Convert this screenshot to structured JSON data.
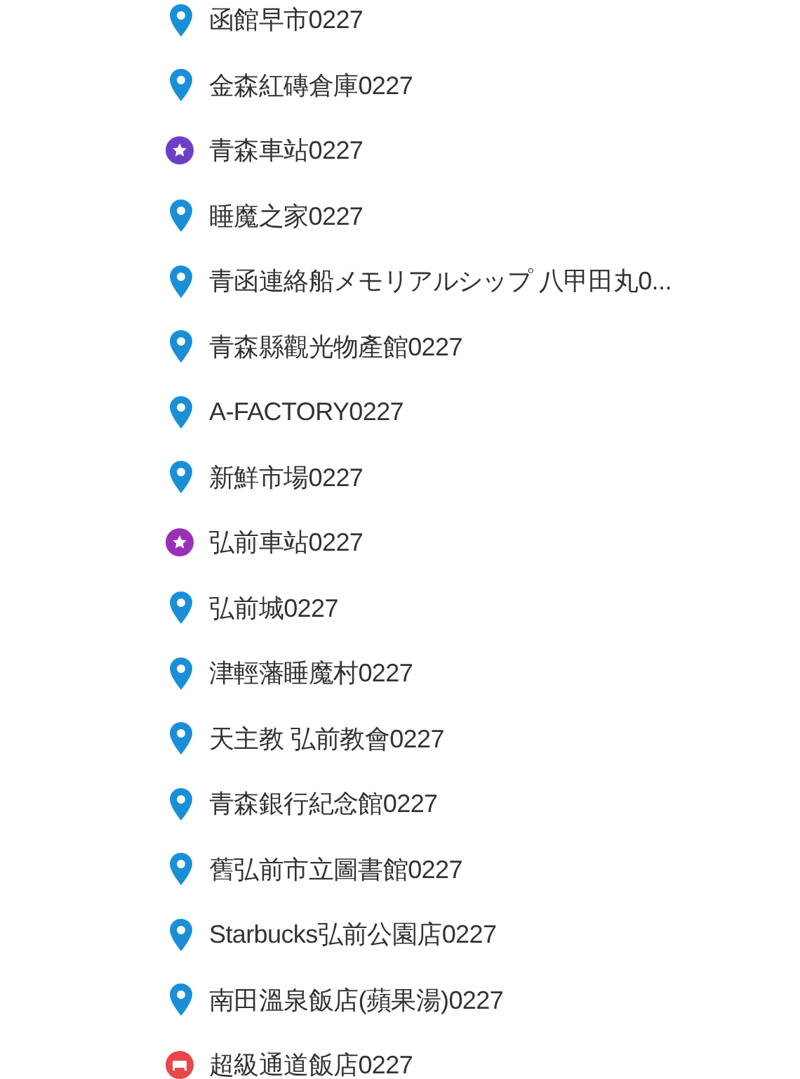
{
  "places": [
    {
      "name": "函館早市0227",
      "kind": "pin",
      "color": "#1a8fd8"
    },
    {
      "name": "金森紅磚倉庫0227",
      "kind": "pin",
      "color": "#1a8fd8"
    },
    {
      "name": "青森車站0227",
      "kind": "star",
      "color": "#6e3fc4"
    },
    {
      "name": "睡魔之家0227",
      "kind": "pin",
      "color": "#1a8fd8"
    },
    {
      "name": "青函連絡船メモリアルシップ 八甲田丸0...",
      "kind": "pin",
      "color": "#1a8fd8"
    },
    {
      "name": "青森縣觀光物產館0227",
      "kind": "pin",
      "color": "#1a8fd8"
    },
    {
      "name": "A-FACTORY0227",
      "kind": "pin",
      "color": "#1a8fd8"
    },
    {
      "name": "新鮮市場0227",
      "kind": "pin",
      "color": "#1a8fd8"
    },
    {
      "name": "弘前車站0227",
      "kind": "star",
      "color": "#9c2fb8"
    },
    {
      "name": "弘前城0227",
      "kind": "pin",
      "color": "#1a8fd8"
    },
    {
      "name": "津輕藩睡魔村0227",
      "kind": "pin",
      "color": "#1a8fd8"
    },
    {
      "name": "天主教 弘前教會0227",
      "kind": "pin",
      "color": "#1a8fd8"
    },
    {
      "name": "青森銀行紀念館0227",
      "kind": "pin",
      "color": "#1a8fd8"
    },
    {
      "name": "舊弘前市立圖書館0227",
      "kind": "pin",
      "color": "#1a8fd8"
    },
    {
      "name": "Starbucks弘前公園店0227",
      "kind": "pin",
      "color": "#1a8fd8"
    },
    {
      "name": "南田溫泉飯店(蘋果湯)0227",
      "kind": "pin",
      "color": "#1a8fd8"
    },
    {
      "name": "超級通道飯店0227",
      "kind": "hotel",
      "color": "#e8484c"
    }
  ]
}
